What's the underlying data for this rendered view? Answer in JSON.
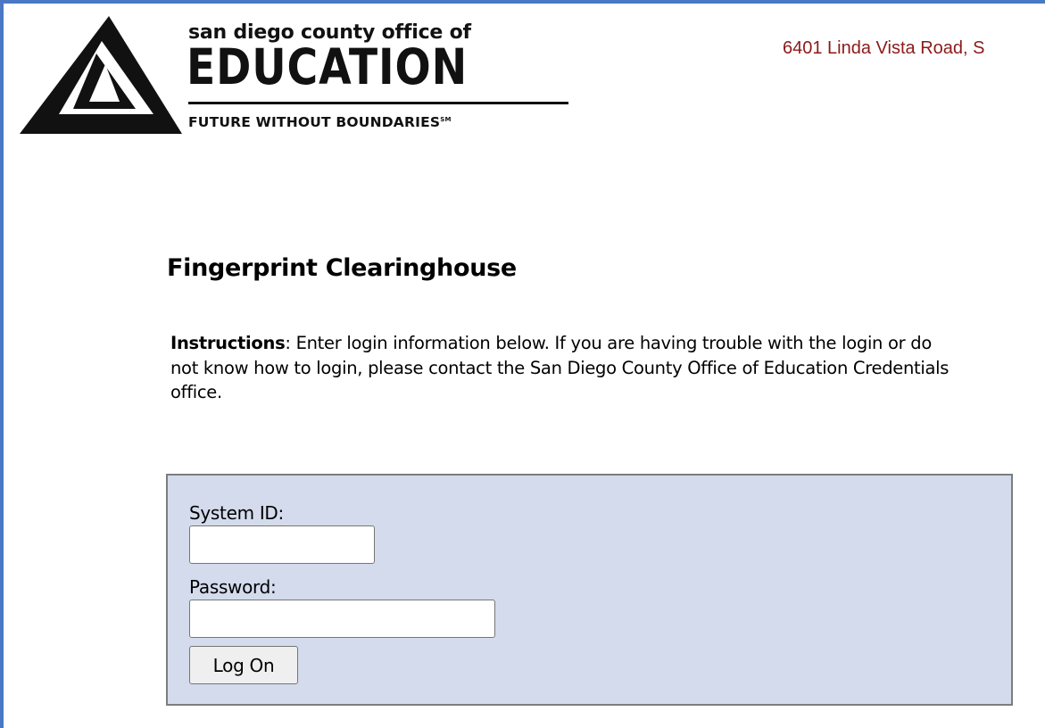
{
  "header": {
    "logo_top_line": "san diego county office of",
    "logo_main_word": "EDUCATION",
    "logo_tagline": "FUTURE WITHOUT BOUNDARIES",
    "logo_tagline_mark": "SM",
    "address": "6401 Linda Vista Road, S"
  },
  "page": {
    "title": "Fingerprint Clearinghouse",
    "instructions_label": "Instructions",
    "instructions_text": ": Enter login information below. If you are having trouble with the login or do not know how to login, please contact the San Diego County Office of Education Credentials office."
  },
  "login": {
    "system_id_label": "System ID:",
    "system_id_value": "",
    "password_label": "Password:",
    "password_value": "",
    "submit_label": "Log On"
  },
  "colors": {
    "window_border": "#4a78c2",
    "address_text": "#8b1a1a",
    "login_panel_bg": "#d3dbec",
    "login_panel_border": "#7d7d7d"
  }
}
